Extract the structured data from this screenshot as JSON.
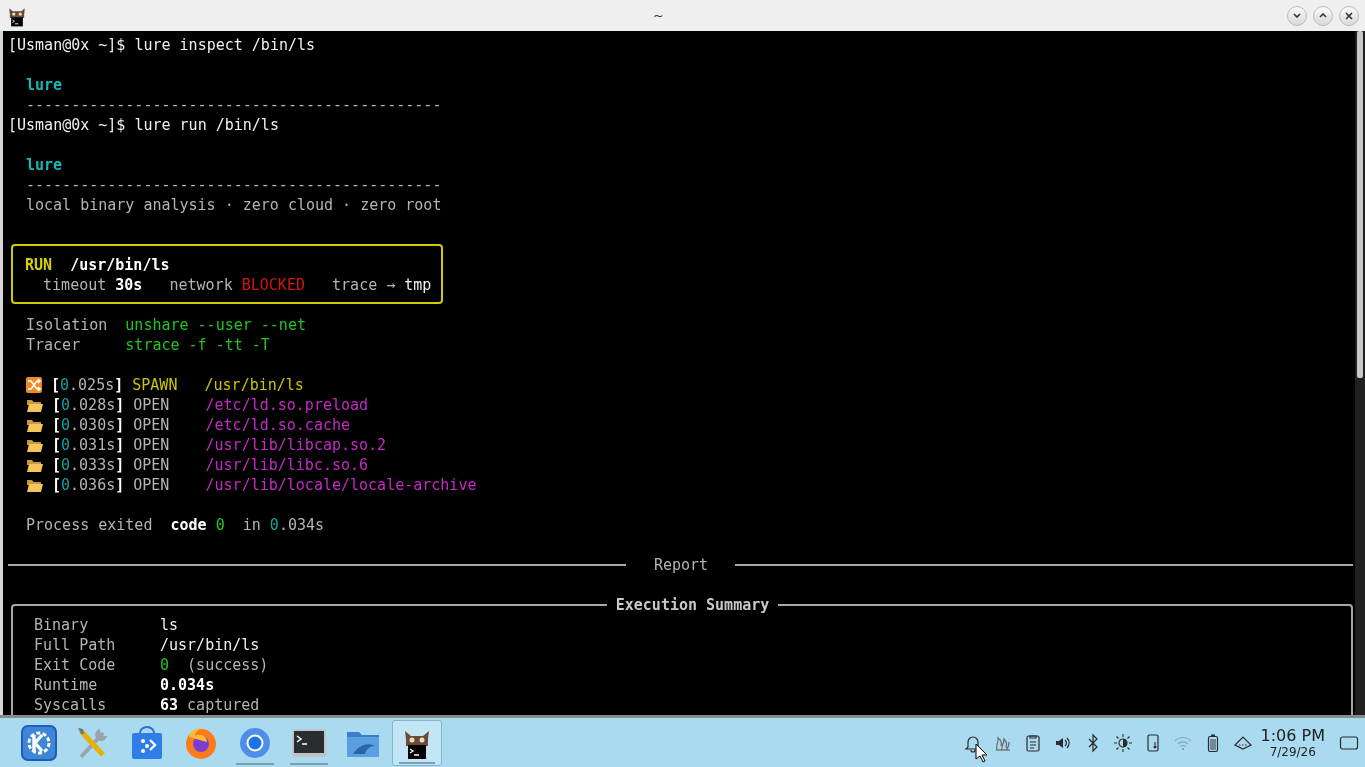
{
  "window": {
    "title": "~",
    "buttons": [
      {
        "kind": "minimize"
      },
      {
        "kind": "maximize"
      },
      {
        "kind": "close"
      }
    ]
  },
  "terminal": {
    "lines": [
      {
        "kind": "prompt",
        "segments": [
          {
            "text": "[Usman@0x ~]$ lure inspect /bin/ls",
            "kind": "command"
          }
        ]
      },
      {
        "kind": "blank"
      },
      {
        "kind": "output",
        "segments": [
          {
            "text": "lure",
            "kind": "heading"
          }
        ]
      },
      {
        "kind": "output",
        "segments": [
          {
            "text": "----------------------------------------------",
            "kind": "plain"
          }
        ]
      },
      {
        "kind": "prompt",
        "segments": [
          {
            "text": "[Usman@0x ~]$ lure run /bin/ls",
            "kind": "command"
          }
        ]
      },
      {
        "kind": "blank"
      },
      {
        "kind": "output",
        "segments": [
          {
            "text": "lure",
            "kind": "heading"
          }
        ]
      },
      {
        "kind": "output",
        "segments": [
          {
            "text": "----------------------------------------------",
            "kind": "plain"
          }
        ]
      },
      {
        "kind": "output",
        "segments": [
          {
            "text": "local binary analysis · zero cloud · zero root",
            "kind": "plain"
          }
        ]
      },
      {
        "kind": "blank"
      },
      {
        "kind": "box",
        "rows": [
          {
            "segments": [
              {
                "text": "RUN  ",
                "kind": "label"
              },
              {
                "text": "/usr/bin/ls",
                "kind": "strong"
              }
            ]
          },
          {
            "segments": [
              {
                "text": "  timeout ",
                "kind": "plain"
              },
              {
                "text": "30s",
                "kind": "strong"
              },
              {
                "text": "   network ",
                "kind": "plain"
              },
              {
                "text": "BLOCKED",
                "kind": "alert"
              },
              {
                "text": "   trace → ",
                "kind": "plain"
              },
              {
                "text": "tmp",
                "kind": "command"
              }
            ]
          }
        ]
      },
      {
        "kind": "output",
        "segments": [
          {
            "text": "Isolation  ",
            "kind": "plain"
          },
          {
            "text": "unshare --user --net",
            "kind": "ok"
          }
        ]
      },
      {
        "kind": "output",
        "segments": [
          {
            "text": "Tracer     ",
            "kind": "plain"
          },
          {
            "text": "strace -f -tt -T",
            "kind": "ok"
          }
        ]
      },
      {
        "kind": "blank"
      },
      {
        "kind": "spawn",
        "segments": [
          {
            "text": "[",
            "kind": "strong"
          },
          {
            "text": "0",
            "kind": "number"
          },
          {
            "text": ".025s",
            "kind": "plain"
          },
          {
            "text": "] ",
            "kind": "strong"
          },
          {
            "text": "SPAWN   /usr/bin/ls",
            "kind": "accent"
          }
        ]
      },
      {
        "kind": "open",
        "segments": [
          {
            "text": "[",
            "kind": "strong"
          },
          {
            "text": "0",
            "kind": "number"
          },
          {
            "text": ".028s",
            "kind": "plain"
          },
          {
            "text": "] ",
            "kind": "strong"
          },
          {
            "text": "OPEN    ",
            "kind": "plain"
          },
          {
            "text": "/etc/ld.so.preload",
            "kind": "path"
          }
        ]
      },
      {
        "kind": "open",
        "segments": [
          {
            "text": "[",
            "kind": "strong"
          },
          {
            "text": "0",
            "kind": "number"
          },
          {
            "text": ".030s",
            "kind": "plain"
          },
          {
            "text": "] ",
            "kind": "strong"
          },
          {
            "text": "OPEN    ",
            "kind": "plain"
          },
          {
            "text": "/etc/ld.so.cache",
            "kind": "path"
          }
        ]
      },
      {
        "kind": "open",
        "segments": [
          {
            "text": "[",
            "kind": "strong"
          },
          {
            "text": "0",
            "kind": "number"
          },
          {
            "text": ".031s",
            "kind": "plain"
          },
          {
            "text": "] ",
            "kind": "strong"
          },
          {
            "text": "OPEN    ",
            "kind": "plain"
          },
          {
            "text": "/usr/lib/libcap.so.2",
            "kind": "path"
          }
        ]
      },
      {
        "kind": "open",
        "segments": [
          {
            "text": "[",
            "kind": "strong"
          },
          {
            "text": "0",
            "kind": "number"
          },
          {
            "text": ".033s",
            "kind": "plain"
          },
          {
            "text": "] ",
            "kind": "strong"
          },
          {
            "text": "OPEN    ",
            "kind": "plain"
          },
          {
            "text": "/usr/lib/libc.so.6",
            "kind": "path"
          }
        ]
      },
      {
        "kind": "open",
        "segments": [
          {
            "text": "[",
            "kind": "strong"
          },
          {
            "text": "0",
            "kind": "number"
          },
          {
            "text": ".036s",
            "kind": "plain"
          },
          {
            "text": "] ",
            "kind": "strong"
          },
          {
            "text": "OPEN    ",
            "kind": "plain"
          },
          {
            "text": "/usr/lib/locale/locale-archive",
            "kind": "path"
          }
        ]
      },
      {
        "kind": "blank"
      },
      {
        "kind": "output",
        "segments": [
          {
            "text": "Process exited  ",
            "kind": "plain"
          },
          {
            "text": "code ",
            "kind": "strong"
          },
          {
            "text": "0",
            "kind": "ok"
          },
          {
            "text": "  in ",
            "kind": "plain"
          },
          {
            "text": "0",
            "kind": "number"
          },
          {
            "text": ".034s",
            "kind": "plain"
          }
        ]
      },
      {
        "kind": "blank"
      },
      {
        "kind": "rule",
        "title": "Report"
      },
      {
        "kind": "blank"
      },
      {
        "kind": "summary",
        "title": "Execution Summary",
        "rows": [
          {
            "label": "Binary",
            "value": [
              {
                "text": "ls",
                "kind": "command"
              }
            ]
          },
          {
            "label": "Full Path",
            "value": [
              {
                "text": "/usr/bin/ls",
                "kind": "command"
              }
            ]
          },
          {
            "label": "Exit Code",
            "value": [
              {
                "text": "0",
                "kind": "ok"
              },
              {
                "text": "  (success)",
                "kind": "plain"
              }
            ]
          },
          {
            "label": "Runtime",
            "value": [
              {
                "text": "0.034s",
                "kind": "strong"
              }
            ]
          },
          {
            "label": "Syscalls",
            "value": [
              {
                "text": "63",
                "kind": "strong"
              },
              {
                "text": " captured",
                "kind": "plain"
              }
            ]
          }
        ]
      }
    ]
  },
  "taskbar": {
    "launchers": [
      {
        "kind": "kde",
        "running": false,
        "selected": false
      },
      {
        "kind": "tools",
        "running": false,
        "selected": false
      },
      {
        "kind": "store",
        "running": false,
        "selected": false
      },
      {
        "kind": "firefox",
        "running": false,
        "selected": false
      },
      {
        "kind": "chromium",
        "running": true,
        "selected": false
      },
      {
        "kind": "terminal",
        "running": true,
        "selected": false
      },
      {
        "kind": "files",
        "running": false,
        "selected": false
      },
      {
        "kind": "catterm",
        "running": true,
        "selected": true
      }
    ],
    "tray": [
      {
        "kind": "bell",
        "disabled": false
      },
      {
        "kind": "flame",
        "disabled": false
      },
      {
        "kind": "clipboard",
        "disabled": false
      },
      {
        "kind": "volume",
        "disabled": false
      },
      {
        "kind": "bluetooth",
        "disabled": false
      },
      {
        "kind": "brightness",
        "disabled": false
      },
      {
        "kind": "phone",
        "disabled": false
      },
      {
        "kind": "wifi",
        "disabled": true
      },
      {
        "kind": "battery",
        "disabled": false
      },
      {
        "kind": "vault",
        "disabled": false
      }
    ],
    "clock": {
      "time": "1:06 PM",
      "date": "7/29/26"
    }
  }
}
